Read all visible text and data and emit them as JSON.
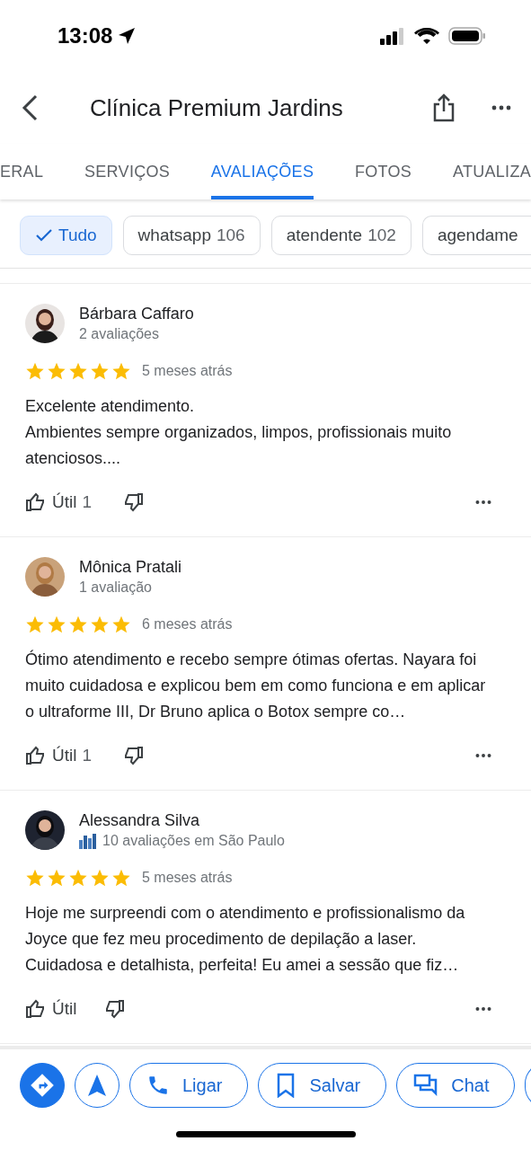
{
  "status_bar": {
    "time": "13:08"
  },
  "header": {
    "title": "Clínica Premium Jardins"
  },
  "tabs": [
    {
      "label": "ERAL",
      "selected": false
    },
    {
      "label": "SERVIÇOS",
      "selected": false
    },
    {
      "label": "AVALIAÇÕES",
      "selected": true
    },
    {
      "label": "FOTOS",
      "selected": false
    },
    {
      "label": "ATUALIZA",
      "selected": false
    }
  ],
  "filters": [
    {
      "label": "Tudo",
      "selected": true
    },
    {
      "label": "whatsapp",
      "count": "106",
      "selected": false
    },
    {
      "label": "atendente",
      "count": "102",
      "selected": false
    },
    {
      "label": "agendame",
      "selected": false
    }
  ],
  "reviews": [
    {
      "name": "Bárbara Caffaro",
      "meta": "2 avaliações",
      "local_guide": false,
      "stars": 5,
      "time": "5 meses atrás",
      "text": "Excelente atendimento.\nAmbientes sempre organizados, limpos, profissionais muito atenciosos....",
      "helpful": "Útil",
      "helpful_count": "1"
    },
    {
      "name": "Mônica Pratali",
      "meta": "1 avaliação",
      "local_guide": false,
      "stars": 5,
      "time": "6 meses atrás",
      "text": "Ótimo atendimento e recebo sempre ótimas ofertas. Nayara foi muito cuidadosa e explicou bem em como funciona e em aplicar o ultraforme III, Dr Bruno aplica o Botox sempre co…",
      "helpful": "Útil",
      "helpful_count": "1"
    },
    {
      "name": "Alessandra Silva",
      "meta": "10 avaliações em São Paulo",
      "local_guide": true,
      "stars": 5,
      "time": "5 meses atrás",
      "text": "Hoje me surpreendi com o atendimento e profissionalismo da Joyce que fez meu procedimento de depilação a laser. Cuidadosa e detalhista, perfeita! Eu amei a sessão que fiz…",
      "helpful": "Útil"
    }
  ],
  "actions": [
    {
      "kind": "directions"
    },
    {
      "kind": "start"
    },
    {
      "kind": "call",
      "label": "Ligar"
    },
    {
      "kind": "save",
      "label": "Salvar"
    },
    {
      "kind": "chat",
      "label": "Chat"
    },
    {
      "kind": "partial"
    }
  ]
}
